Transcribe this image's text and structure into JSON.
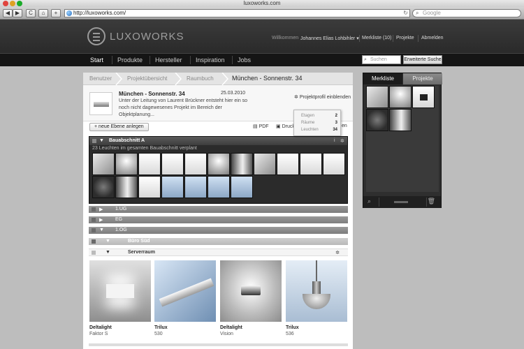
{
  "window": {
    "title": "luxoworks.com"
  },
  "browser": {
    "url": "http://luxoworks.com/",
    "search_placeholder": "Google",
    "back_icon": "◀",
    "forward_icon": "▶",
    "reload_icon": "C",
    "home_icon": "⌂",
    "add_icon": "+"
  },
  "header": {
    "logo_text": "LUXOWORKS",
    "welcome": "Willkommen",
    "user_name": "Johannes Elias Lohbihler",
    "merkliste_link": "Merkliste (10)",
    "projekte_link": "Projekte",
    "logout_link": "Abmelden"
  },
  "main_nav": {
    "items": [
      "Start",
      "Produkte",
      "Hersteller",
      "Inspiration",
      "Jobs"
    ],
    "search_placeholder": "Suchen",
    "advanced_search": "Erweiterte Suche"
  },
  "breadcrumb": {
    "items": [
      "Benutzer",
      "Projektübersicht",
      "Raumbuch",
      "München - Sonnenstr. 34"
    ]
  },
  "project": {
    "title": "München - Sonnenstr. 34",
    "date": "25.03.2010",
    "description": "Unter der Leitung von Laurent Brückner entsteht hier ein so noch nicht dagewesenes Projekt im Bereich der Objektplanung...",
    "profile_link": "Projektprofil einblenden"
  },
  "actions": {
    "new_level": "neue Ebene anlegen",
    "pdf": "PDF",
    "print": "Druck",
    "more": "en"
  },
  "stats": {
    "rows": [
      {
        "label": "Etagen",
        "value": "2"
      },
      {
        "label": "Räume",
        "value": "3"
      },
      {
        "label": "Leuchten",
        "value": "34"
      }
    ]
  },
  "section_a": {
    "title": "Bauabschnitt A",
    "subtitle": "23 Leuchten im gesamten Bauabschnitt verplant",
    "info_icon": "i",
    "gear_icon": "✲"
  },
  "levels": [
    {
      "label": "1.UG"
    },
    {
      "label": "EG"
    },
    {
      "label": "1.OG"
    }
  ],
  "room_group": {
    "label": "Büro Süd"
  },
  "room": {
    "label": "Serverraum",
    "gear_icon": "✲"
  },
  "products": [
    {
      "brand": "Deltalight",
      "name": "Faktor S"
    },
    {
      "brand": "Trilux",
      "name": "530"
    },
    {
      "brand": "Deltalight",
      "name": "Vision"
    },
    {
      "brand": "Trilux",
      "name": "536"
    }
  ],
  "merkliste": {
    "tab_active": "Merkliste",
    "tab_inactive": "Projekte"
  },
  "icons": {
    "triangle_down": "▼",
    "triangle_right": "▶",
    "gear": "✲",
    "magnifier": "⌕",
    "trash": "🗑",
    "pdf": "📄",
    "print": "🖶"
  },
  "colors": {
    "header_bg": "#2f2f2f",
    "nav_bg": "#151515",
    "page_bg": "#bdbdbd"
  }
}
